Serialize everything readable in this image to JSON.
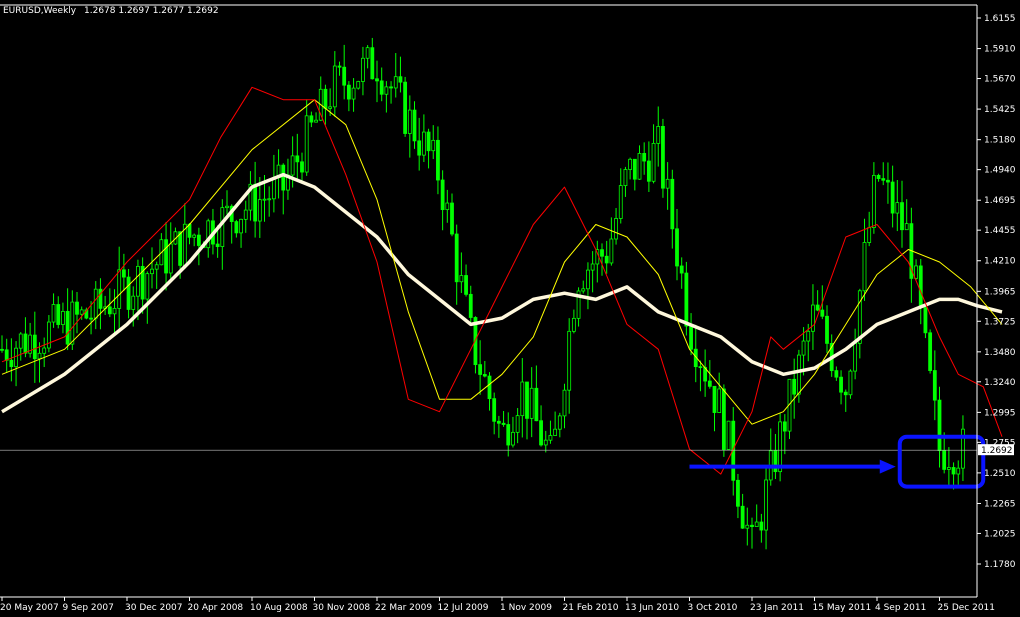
{
  "header": {
    "symbol": "EURUSD,Weekly",
    "ohlc": "1.2678 1.2697 1.2677 1.2692"
  },
  "current_price_label": "1.2692",
  "colors": {
    "background": "#000000",
    "candles": "#00ff00",
    "ma_fast": "#ff0000",
    "ma_medium": "#ffff00",
    "ma_slow": "#fff8dc",
    "annotation": "#0a14ff",
    "axis": "#ffffff"
  },
  "chart_data": {
    "type": "line",
    "title": "",
    "xlabel": "",
    "ylabel": "",
    "ylim": [
      1.17,
      1.62
    ],
    "y_ticks": [
      1.6155,
      1.591,
      1.567,
      1.5425,
      1.518,
      1.494,
      1.4695,
      1.4455,
      1.421,
      1.3965,
      1.3725,
      1.348,
      1.324,
      1.2995,
      1.2755,
      1.251,
      1.2265,
      1.2025,
      1.178
    ],
    "x_ticks": [
      "20 May 2007",
      "9 Sep 2007",
      "30 Dec 2007",
      "20 Apr 2008",
      "10 Aug 2008",
      "30 Nov 2008",
      "22 Mar 2009",
      "12 Jul 2009",
      "1 Nov 2009",
      "21 Feb 2010",
      "13 Jun 2010",
      "3 Oct 2010",
      "23 Jan 2011",
      "15 May 2011",
      "4 Sep 2011",
      "25 Dec 2011"
    ],
    "grid": false,
    "series": [
      {
        "style": "candles",
        "x": [
          0,
          1.5,
          3,
          4.5,
          5.3,
          6,
          7,
          7.5,
          8,
          8.3,
          8.8,
          9.2,
          9.7,
          10,
          10.5,
          10.8,
          11,
          11.5,
          12,
          12.5,
          13,
          13.5,
          14,
          14.5,
          15
        ],
        "values": [
          1.35,
          1.38,
          1.44,
          1.48,
          1.56,
          1.58,
          1.49,
          1.36,
          1.28,
          1.32,
          1.26,
          1.41,
          1.43,
          1.49,
          1.51,
          1.43,
          1.37,
          1.3,
          1.19,
          1.29,
          1.38,
          1.32,
          1.49,
          1.44,
          1.27
        ]
      },
      {
        "name": "",
        "style": "ma_fast",
        "x": [
          0,
          1,
          2,
          3,
          3.5,
          4,
          4.5,
          5,
          5.5,
          6,
          6.5,
          7,
          7.5,
          8,
          8.5,
          9,
          9.5,
          10,
          10.5,
          11,
          11.5,
          12,
          12.3,
          12.5,
          13,
          13.5,
          14,
          14.5,
          15,
          15.3,
          15.7,
          16
        ],
        "values": [
          1.34,
          1.36,
          1.42,
          1.47,
          1.52,
          1.56,
          1.55,
          1.55,
          1.49,
          1.42,
          1.31,
          1.3,
          1.35,
          1.4,
          1.45,
          1.48,
          1.43,
          1.37,
          1.35,
          1.27,
          1.25,
          1.3,
          1.36,
          1.35,
          1.37,
          1.44,
          1.45,
          1.42,
          1.36,
          1.33,
          1.32,
          1.28
        ]
      },
      {
        "name": "",
        "style": "ma_medium",
        "x": [
          0,
          1,
          2,
          3,
          4,
          5,
          5.5,
          6,
          6.5,
          7,
          7.5,
          8,
          8.5,
          9,
          9.5,
          10,
          10.5,
          11,
          11.5,
          12,
          12.5,
          13,
          13.5,
          14,
          14.5,
          15,
          15.5,
          16
        ],
        "values": [
          1.33,
          1.35,
          1.4,
          1.45,
          1.51,
          1.55,
          1.53,
          1.47,
          1.38,
          1.31,
          1.31,
          1.33,
          1.36,
          1.42,
          1.45,
          1.44,
          1.41,
          1.35,
          1.32,
          1.29,
          1.3,
          1.33,
          1.37,
          1.41,
          1.43,
          1.42,
          1.4,
          1.37
        ]
      },
      {
        "name": "",
        "style": "ma_slow",
        "x": [
          0,
          1,
          2,
          3,
          4,
          4.5,
          5,
          5.5,
          6,
          6.5,
          7,
          7.5,
          8,
          8.5,
          9,
          9.5,
          10,
          10.5,
          11,
          11.5,
          12,
          12.5,
          13,
          13.5,
          14,
          14.5,
          15,
          15.3,
          15.6,
          16
        ],
        "values": [
          1.3,
          1.33,
          1.37,
          1.42,
          1.48,
          1.49,
          1.48,
          1.46,
          1.44,
          1.41,
          1.39,
          1.37,
          1.375,
          1.39,
          1.395,
          1.39,
          1.4,
          1.38,
          1.37,
          1.36,
          1.34,
          1.33,
          1.335,
          1.35,
          1.37,
          1.38,
          1.39,
          1.39,
          1.385,
          1.38
        ]
      }
    ],
    "annotations": [
      {
        "type": "arrow",
        "from": [
          11,
          1.256
        ],
        "to": [
          14.3,
          1.256
        ]
      },
      {
        "type": "box",
        "x_range": [
          14.3,
          15.7
        ],
        "y_range": [
          1.24,
          1.28
        ]
      }
    ]
  }
}
